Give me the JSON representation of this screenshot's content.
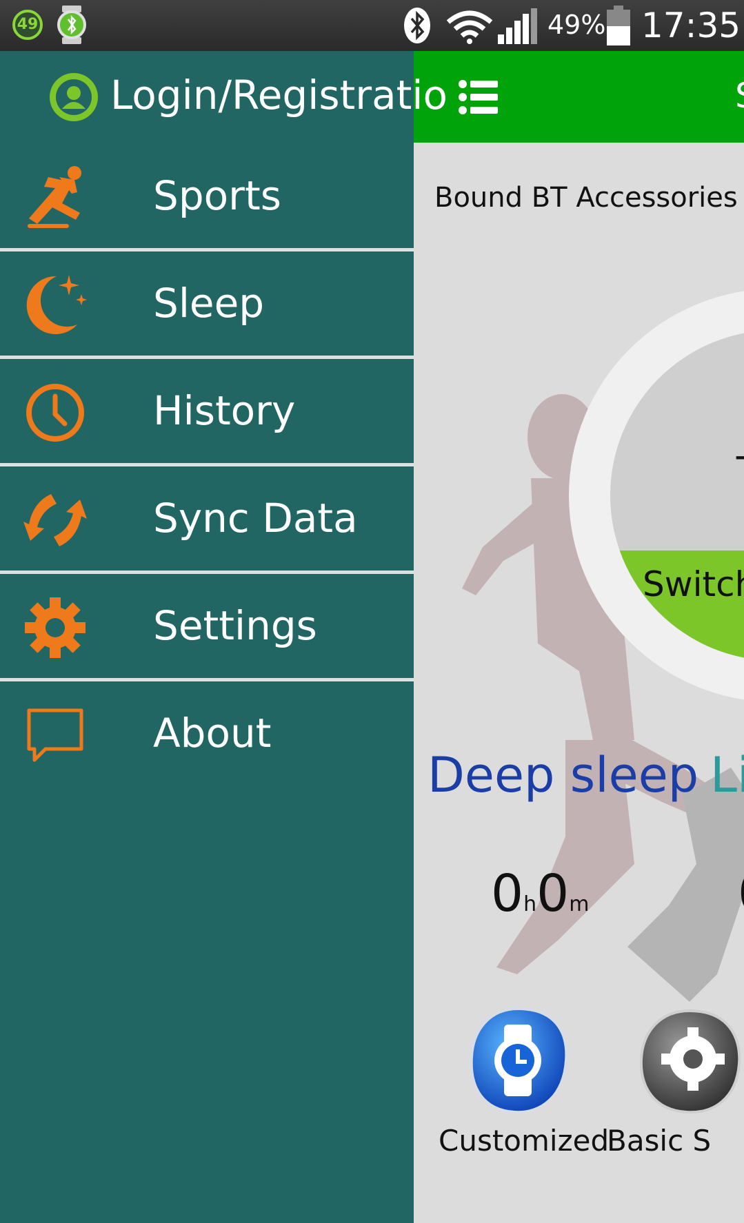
{
  "status_bar": {
    "notification_badge": "49",
    "battery_percent": "49%",
    "time": "17:35"
  },
  "drawer": {
    "login_label": "Login/Registratio",
    "items": [
      {
        "label": "Sports",
        "icon": "running-icon"
      },
      {
        "label": "Sleep",
        "icon": "moon-icon"
      },
      {
        "label": "History",
        "icon": "clock-icon"
      },
      {
        "label": "Sync Data",
        "icon": "sync-icon"
      },
      {
        "label": "Settings",
        "icon": "gear-icon"
      },
      {
        "label": "About",
        "icon": "chat-bubble-icon"
      }
    ]
  },
  "main": {
    "header_title": "S",
    "bound_label": "Bound BT Accessories",
    "dial_dash": "-",
    "switch_label": "Switch",
    "deep_sleep_label": "Deep sleep",
    "light_sleep_label": "Li",
    "deep_sleep_value": {
      "hours": "0",
      "h_unit": "h",
      "minutes": "0",
      "m_unit": "m"
    },
    "second_value_partial": "0",
    "buttons": [
      {
        "label": "Customized",
        "icon": "watch-icon"
      },
      {
        "label": "Basic S",
        "icon": "gear-icon"
      }
    ]
  },
  "colors": {
    "drawer_bg": "#226663",
    "header_green": "#00a30a",
    "accent_orange": "#ef7a1b",
    "sleep_blue": "#1a3da6",
    "light_teal": "#2a9a9a",
    "switch_green": "#7cc629"
  }
}
